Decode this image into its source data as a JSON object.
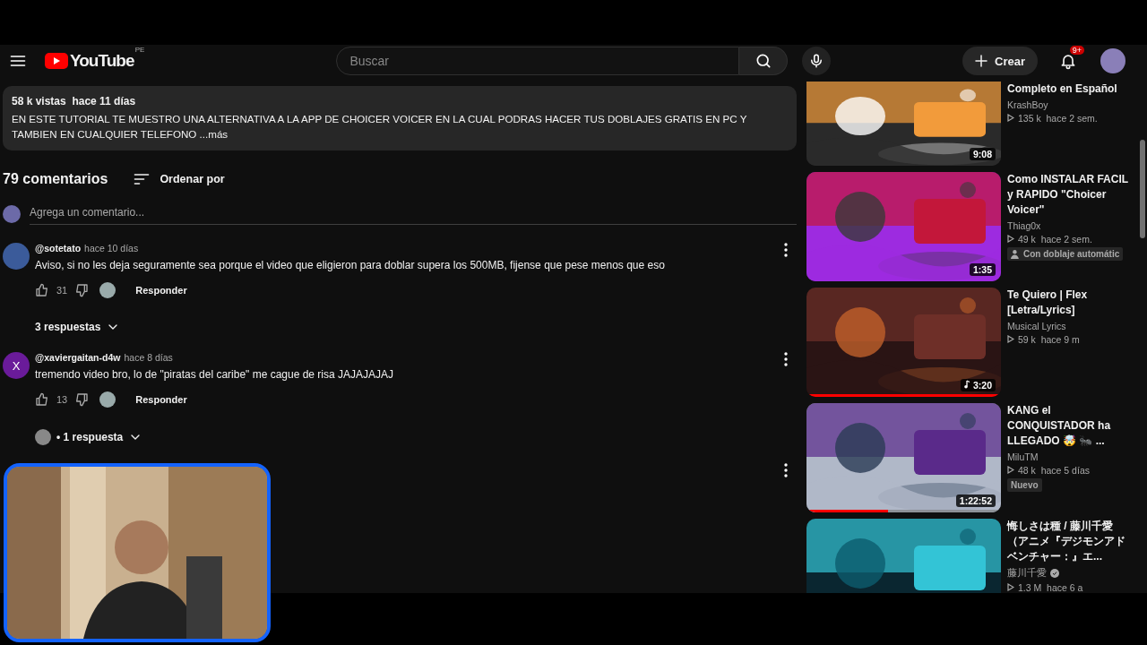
{
  "header": {
    "logo_text": "YouTube",
    "region": "PE",
    "search_placeholder": "Buscar",
    "create_label": "Crear",
    "notification_badge": "9+"
  },
  "description": {
    "meta": "58 k vistas  hace 11 días",
    "text": "EN ESTE TUTORIAL TE MUESTRO UNA ALTERNATIVA A LA APP DE CHOICER VOICER EN LA CUAL PODRAS HACER TUS DOBLAJES GRATIS EN PC Y TAMBIEN EN CUALQUIER TELEFONO ...más"
  },
  "comments": {
    "count": "79 comentarios",
    "sort_label": "Ordenar por",
    "add_placeholder": "Agrega un comentario...",
    "items": [
      {
        "kind": "comment",
        "author": "@sotetato",
        "time": "hace 10 días",
        "color": "#3b5b9a",
        "text": "Aviso, si no les deja seguramente sea porque el video que eligieron para doblar supera los 500MB, fijense que pese menos que eso",
        "likes": "31",
        "reply": "Responder",
        "replies": "3 respuestas",
        "replies_avatar": false
      },
      {
        "kind": "comment",
        "author": "@xaviergaitan-d4w",
        "time": "hace 8 días",
        "avatar_letter": "X",
        "color": "#6a1b9a",
        "text": "tremendo video bro, lo de \"piratas del caribe\" me cague de risa JAJAJAJAJ",
        "likes": "13",
        "reply": "Responder",
        "replies": "• 1 respuesta",
        "replies_avatar": true
      },
      {
        "kind": "hidden"
      }
    ]
  },
  "sidebar": [
    {
      "title": "Completo en Español",
      "channel": "KrashBoy",
      "stats": "135 k  hace 2 sem.",
      "duration": "9:08",
      "music": false,
      "verified": false,
      "cut_top": true
    },
    {
      "title": "Como INSTALAR FACIL y RAPIDO \"Choicer Voicer\"",
      "channel": "Thiag0x",
      "stats": "49 k  hace 2 sem.",
      "duration": "1:35",
      "music": false,
      "verified": false,
      "cut_top": false,
      "badge": "Con doblaje automátic",
      "badge_icon": true
    },
    {
      "title": "Te Quiero | Flex [Letra/Lyrics]",
      "channel": "Musical Lyrics",
      "stats": "59 k  hace 9 m",
      "duration": "3:20",
      "music": true,
      "verified": false,
      "cut_top": false,
      "level": 1
    },
    {
      "title": "KANG el CONQUISTADOR ha LLEGADO 🤯 🐜 ...",
      "channel": "MiluTM",
      "stats": "48 k  hace 5 días",
      "duration": "1:22:52",
      "music": false,
      "verified": false,
      "cut_top": false,
      "level": 0.42,
      "badge": "Nuevo",
      "badge_icon": false
    },
    {
      "title": "悔しさは種 / 藤川千愛（アニメ『デジモンアドベンチャー：』エ...",
      "channel": "藤川千愛",
      "stats": "1.3 M  hace 6 a",
      "verified": true,
      "cut_top": false
    }
  ]
}
